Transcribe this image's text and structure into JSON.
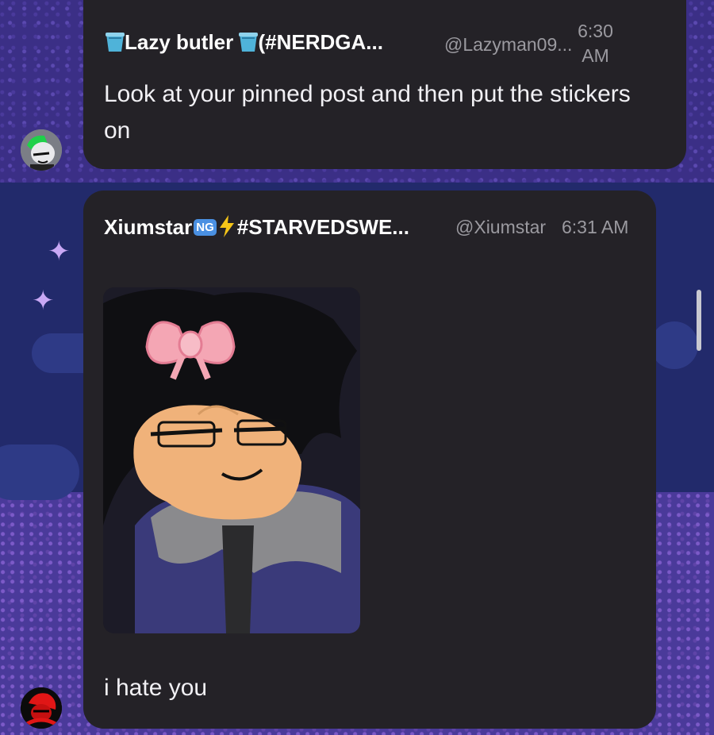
{
  "messages": [
    {
      "author": "Lazy butler",
      "tag": "(#NERDGA...",
      "handle": "@Lazyman09...",
      "time_line1": "6:30",
      "time_line2": "AM",
      "text": "Look at your pinned post and then put the stickers on",
      "name_icons": [
        "bucket-icon",
        "bucket-icon"
      ]
    },
    {
      "author": "Xiumstar",
      "tag": "#STARVEDSWE...",
      "handle": "@Xiumstar",
      "time": "6:31 AM",
      "badge": "NG",
      "text": "i hate you",
      "name_icons": [
        "ng-badge-icon",
        "lightning-icon"
      ],
      "image": "cartoon-character-with-pink-bow"
    }
  ],
  "colors": {
    "bubble": "#242227",
    "name": "#ffffff",
    "meta": "#9b9aa0",
    "body": "#f1f0f4",
    "badge": "#4a90e2",
    "lightning": "#f5c518",
    "bow": "#f4a6b4"
  }
}
